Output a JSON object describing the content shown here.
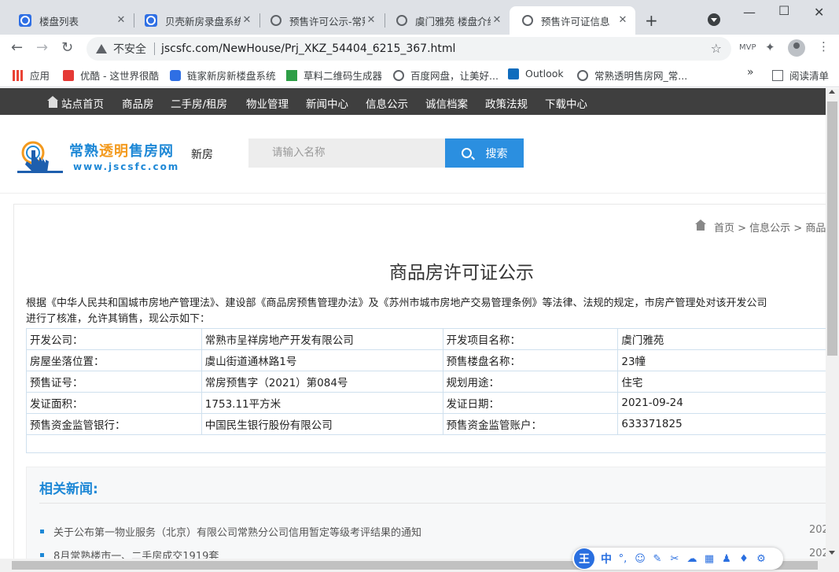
{
  "browser": {
    "tabs": [
      {
        "title": "楼盘列表",
        "active": false
      },
      {
        "title": "贝壳新房录盘系统",
        "active": false
      },
      {
        "title": "预售许可公示-常熟",
        "active": false
      },
      {
        "title": "虞门雅苑 楼盘介绍",
        "active": false
      },
      {
        "title": "预售许可证信息",
        "active": true
      }
    ],
    "insecure_label": "不安全",
    "url": "jscsfc.com/NewHouse/Prj_XKZ_54404_6215_367.html",
    "ext_label": "MVP",
    "bookmarks": [
      {
        "label": "应用",
        "icon": "apps-grid-icon"
      },
      {
        "label": "优酷 - 这世界很酷",
        "icon": "youku-icon"
      },
      {
        "label": "链家新房新楼盘系统",
        "icon": "lianjia-icon"
      },
      {
        "label": "草料二维码生成器",
        "icon": "qrcode-icon"
      },
      {
        "label": "百度网盘，让美好...",
        "icon": "globe-icon"
      },
      {
        "label": "Outlook",
        "icon": "outlook-icon"
      },
      {
        "label": "常熟透明售房网_常...",
        "icon": "globe-icon"
      }
    ],
    "more_bookmarks": "»",
    "reading_list": "阅读清单"
  },
  "site": {
    "nav": [
      "站点首页",
      "商品房",
      "二手房/租房",
      "物业管理",
      "新闻中心",
      "信息公示",
      "诚信档案",
      "政策法规",
      "下载中心"
    ],
    "logo_title_a": "常熟",
    "logo_title_b": "透明",
    "logo_title_c": "售房网",
    "logo_url": "www.jscsfc.com",
    "header_new": "新房",
    "search_placeholder": "请输入名称",
    "search_button": "搜索",
    "breadcrumb": "首页 > 信息公示 > 商品"
  },
  "main": {
    "title": "商品房许可证公示",
    "intro_line1": "根据《中华人民共和国城市房地产管理法》、建设部《商品房预售管理办法》及《苏州市城市房地产交易管理条例》等法律、法规的规定，市房产管理处对该开发公司",
    "intro_line2": "进行了核准，允许其销售，现公示如下：",
    "rows": [
      {
        "l1": "开发公司：",
        "v1": "常熟市呈祥房地产开发有限公司",
        "l2": "开发项目名称：",
        "v2": "虞门雅苑"
      },
      {
        "l1": "房屋坐落位置：",
        "v1": "虞山街道通林路1号",
        "l2": "预售楼盘名称：",
        "v2": "23幢"
      },
      {
        "l1": "预售证号：",
        "v1": "常房预售字（2021）第084号",
        "l2": "规划用途：",
        "v2": "住宅"
      },
      {
        "l1": "发证面积：",
        "v1": "1753.11平方米",
        "l2": "发证日期：",
        "v2": "2021-09-24"
      },
      {
        "l1": "预售资金监管银行：",
        "v1": "中国民生银行股份有限公司",
        "l2": "预售资金监管账户：",
        "v2": "633371825"
      }
    ]
  },
  "news": {
    "heading": "相关新闻:",
    "items": [
      {
        "title": "关于公布第一物业服务（北京）有限公司常熟分公司信用暂定等级考评结果的通知",
        "date": "202"
      },
      {
        "title": "8月常熟楼市一、二手房成交1919套",
        "date": "202"
      }
    ]
  },
  "ime": {
    "logo": "王",
    "mode": "中",
    "punct": "°,"
  }
}
